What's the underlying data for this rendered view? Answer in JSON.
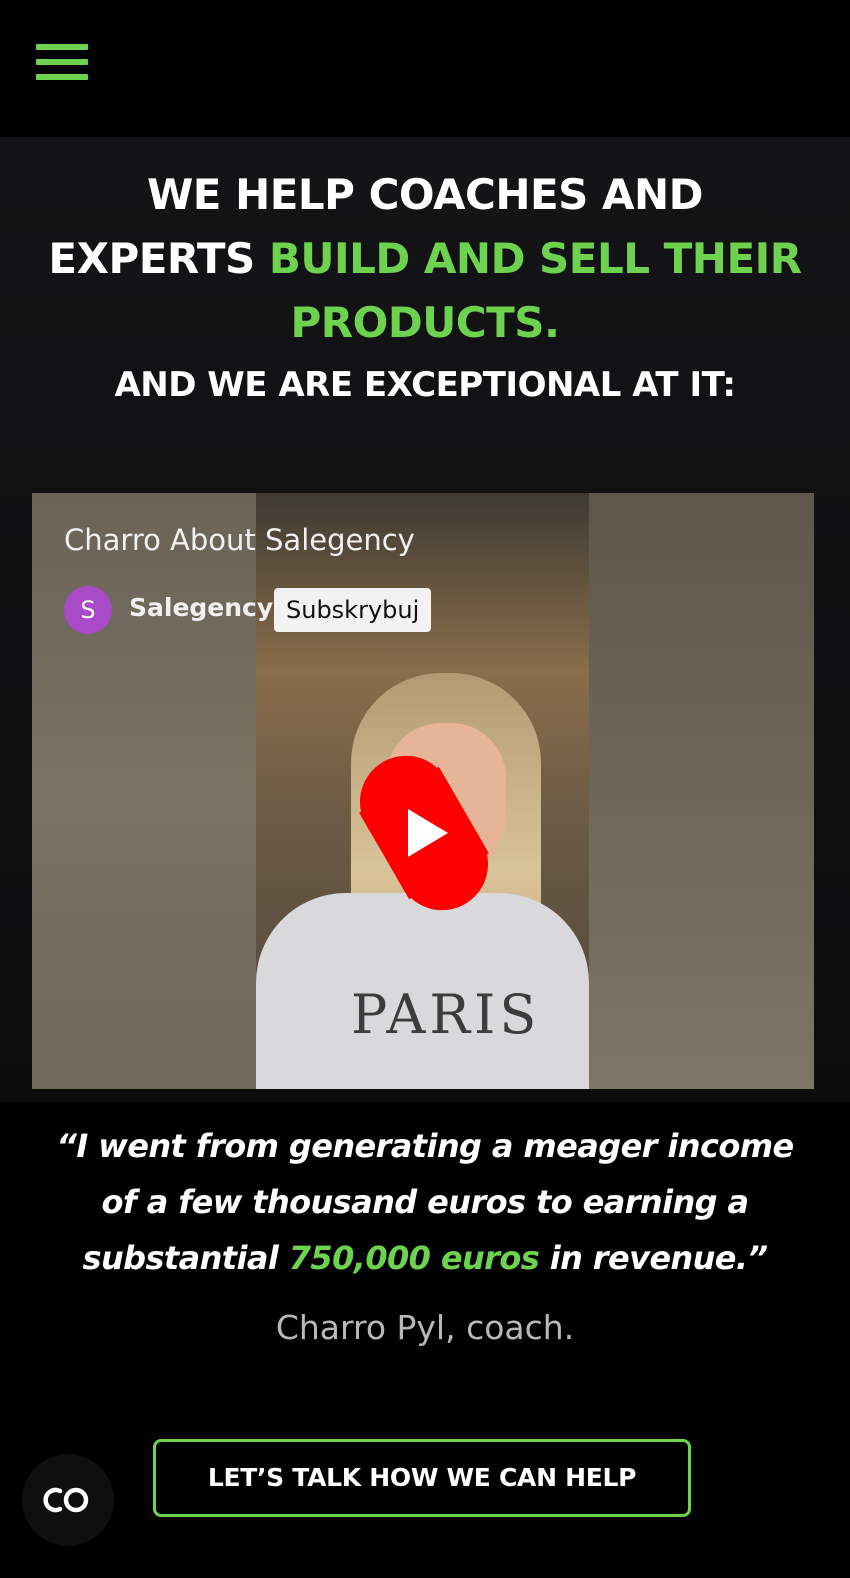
{
  "nav": {
    "menu_icon": "hamburger-menu-icon"
  },
  "hero": {
    "headline_line1": "WE HELP COACHES AND",
    "headline_line2_white": "EXPERTS ",
    "headline_line2_green": "BUILD AND SELL THEIR",
    "headline_line3_green": "PRODUCTS.",
    "subheadline": "AND WE ARE EXCEPTIONAL AT IT:"
  },
  "video": {
    "title": "Charro About Salegency",
    "channel_initial": "S",
    "channel_name": "Salegency",
    "subscribe_label": "Subskrybuj",
    "hoodie_text": "PARIS",
    "play_icon": "youtube-shorts-play-icon"
  },
  "testimonial": {
    "quote_part1": "“I went from generating a meager income of a few thousand euros to earning a substantial ",
    "quote_highlight": "750,000 euros",
    "quote_part2": " in revenue.”",
    "author": "Charro Pyl, coach."
  },
  "cta": {
    "label": "LET’S TALK HOW WE CAN HELP"
  },
  "floating_widget": {
    "icon": "co-logo-icon"
  },
  "colors": {
    "accent": "#6dd34f",
    "background": "#000000",
    "youtube_red": "#ff0000"
  }
}
